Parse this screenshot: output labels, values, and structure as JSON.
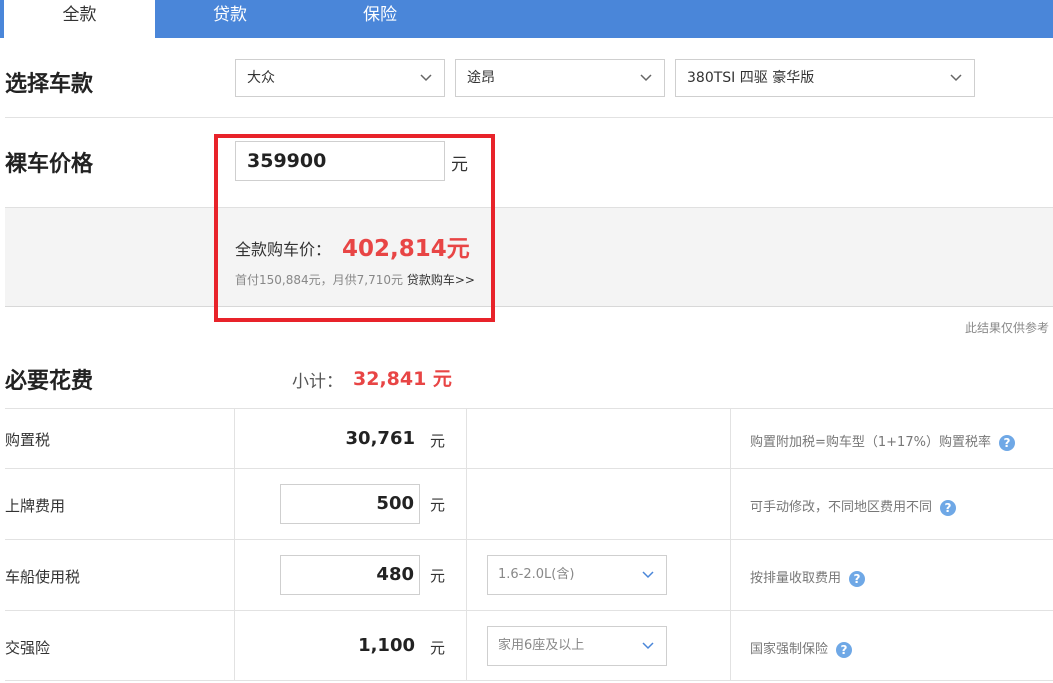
{
  "tabs": [
    {
      "label": "全款",
      "active": true
    },
    {
      "label": "贷款",
      "active": false
    },
    {
      "label": "保险",
      "active": false
    }
  ],
  "select_model": {
    "title": "选择车款",
    "brand": "大众",
    "series": "途昂",
    "model": "380TSI 四驱 豪华版"
  },
  "bare_price": {
    "title": "裸车价格",
    "value": "359900",
    "unit": "元"
  },
  "total": {
    "label": "全款购车价：",
    "value": "402,814元",
    "loan_info": "首付150,884元，月供7,710元",
    "loan_link": "贷款购车>>"
  },
  "note": "此结果仅供参考",
  "required": {
    "title": "必要花费",
    "subtotal_label": "小计：",
    "subtotal_value": "32,841 元",
    "rows": [
      {
        "name": "购置税",
        "amount": "30,761",
        "unit": "元",
        "option": "",
        "note": "购置附加税=购车型（1+17%）购置税率"
      },
      {
        "name": "上牌费用",
        "amount": "500",
        "unit": "元",
        "option": "",
        "note": "可手动修改，不同地区费用不同"
      },
      {
        "name": "车船使用税",
        "amount": "480",
        "unit": "元",
        "option": "1.6-2.0L(含)",
        "note": "按排量收取费用"
      },
      {
        "name": "交强险",
        "amount": "1,100",
        "unit": "元",
        "option": "家用6座及以上",
        "note": "国家强制保险"
      }
    ]
  },
  "help_glyph": "?",
  "colors": {
    "tab_bar": "#4a86d9",
    "accent_red": "#e84545",
    "highlight_border": "#e8232a",
    "help_blue": "#6fa8e6"
  }
}
